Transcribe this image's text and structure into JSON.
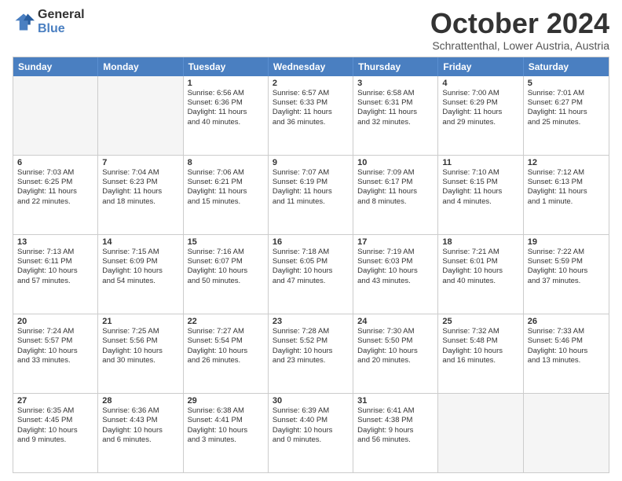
{
  "header": {
    "logo_general": "General",
    "logo_blue": "Blue",
    "title": "October 2024",
    "subtitle": "Schrattenthal, Lower Austria, Austria"
  },
  "weekdays": [
    "Sunday",
    "Monday",
    "Tuesday",
    "Wednesday",
    "Thursday",
    "Friday",
    "Saturday"
  ],
  "rows": [
    [
      {
        "day": "",
        "lines": [],
        "empty": true
      },
      {
        "day": "",
        "lines": [],
        "empty": true
      },
      {
        "day": "1",
        "lines": [
          "Sunrise: 6:56 AM",
          "Sunset: 6:36 PM",
          "Daylight: 11 hours",
          "and 40 minutes."
        ]
      },
      {
        "day": "2",
        "lines": [
          "Sunrise: 6:57 AM",
          "Sunset: 6:33 PM",
          "Daylight: 11 hours",
          "and 36 minutes."
        ]
      },
      {
        "day": "3",
        "lines": [
          "Sunrise: 6:58 AM",
          "Sunset: 6:31 PM",
          "Daylight: 11 hours",
          "and 32 minutes."
        ]
      },
      {
        "day": "4",
        "lines": [
          "Sunrise: 7:00 AM",
          "Sunset: 6:29 PM",
          "Daylight: 11 hours",
          "and 29 minutes."
        ]
      },
      {
        "day": "5",
        "lines": [
          "Sunrise: 7:01 AM",
          "Sunset: 6:27 PM",
          "Daylight: 11 hours",
          "and 25 minutes."
        ]
      }
    ],
    [
      {
        "day": "6",
        "lines": [
          "Sunrise: 7:03 AM",
          "Sunset: 6:25 PM",
          "Daylight: 11 hours",
          "and 22 minutes."
        ]
      },
      {
        "day": "7",
        "lines": [
          "Sunrise: 7:04 AM",
          "Sunset: 6:23 PM",
          "Daylight: 11 hours",
          "and 18 minutes."
        ]
      },
      {
        "day": "8",
        "lines": [
          "Sunrise: 7:06 AM",
          "Sunset: 6:21 PM",
          "Daylight: 11 hours",
          "and 15 minutes."
        ]
      },
      {
        "day": "9",
        "lines": [
          "Sunrise: 7:07 AM",
          "Sunset: 6:19 PM",
          "Daylight: 11 hours",
          "and 11 minutes."
        ]
      },
      {
        "day": "10",
        "lines": [
          "Sunrise: 7:09 AM",
          "Sunset: 6:17 PM",
          "Daylight: 11 hours",
          "and 8 minutes."
        ]
      },
      {
        "day": "11",
        "lines": [
          "Sunrise: 7:10 AM",
          "Sunset: 6:15 PM",
          "Daylight: 11 hours",
          "and 4 minutes."
        ]
      },
      {
        "day": "12",
        "lines": [
          "Sunrise: 7:12 AM",
          "Sunset: 6:13 PM",
          "Daylight: 11 hours",
          "and 1 minute."
        ]
      }
    ],
    [
      {
        "day": "13",
        "lines": [
          "Sunrise: 7:13 AM",
          "Sunset: 6:11 PM",
          "Daylight: 10 hours",
          "and 57 minutes."
        ]
      },
      {
        "day": "14",
        "lines": [
          "Sunrise: 7:15 AM",
          "Sunset: 6:09 PM",
          "Daylight: 10 hours",
          "and 54 minutes."
        ]
      },
      {
        "day": "15",
        "lines": [
          "Sunrise: 7:16 AM",
          "Sunset: 6:07 PM",
          "Daylight: 10 hours",
          "and 50 minutes."
        ]
      },
      {
        "day": "16",
        "lines": [
          "Sunrise: 7:18 AM",
          "Sunset: 6:05 PM",
          "Daylight: 10 hours",
          "and 47 minutes."
        ]
      },
      {
        "day": "17",
        "lines": [
          "Sunrise: 7:19 AM",
          "Sunset: 6:03 PM",
          "Daylight: 10 hours",
          "and 43 minutes."
        ]
      },
      {
        "day": "18",
        "lines": [
          "Sunrise: 7:21 AM",
          "Sunset: 6:01 PM",
          "Daylight: 10 hours",
          "and 40 minutes."
        ]
      },
      {
        "day": "19",
        "lines": [
          "Sunrise: 7:22 AM",
          "Sunset: 5:59 PM",
          "Daylight: 10 hours",
          "and 37 minutes."
        ]
      }
    ],
    [
      {
        "day": "20",
        "lines": [
          "Sunrise: 7:24 AM",
          "Sunset: 5:57 PM",
          "Daylight: 10 hours",
          "and 33 minutes."
        ]
      },
      {
        "day": "21",
        "lines": [
          "Sunrise: 7:25 AM",
          "Sunset: 5:56 PM",
          "Daylight: 10 hours",
          "and 30 minutes."
        ]
      },
      {
        "day": "22",
        "lines": [
          "Sunrise: 7:27 AM",
          "Sunset: 5:54 PM",
          "Daylight: 10 hours",
          "and 26 minutes."
        ]
      },
      {
        "day": "23",
        "lines": [
          "Sunrise: 7:28 AM",
          "Sunset: 5:52 PM",
          "Daylight: 10 hours",
          "and 23 minutes."
        ]
      },
      {
        "day": "24",
        "lines": [
          "Sunrise: 7:30 AM",
          "Sunset: 5:50 PM",
          "Daylight: 10 hours",
          "and 20 minutes."
        ]
      },
      {
        "day": "25",
        "lines": [
          "Sunrise: 7:32 AM",
          "Sunset: 5:48 PM",
          "Daylight: 10 hours",
          "and 16 minutes."
        ]
      },
      {
        "day": "26",
        "lines": [
          "Sunrise: 7:33 AM",
          "Sunset: 5:46 PM",
          "Daylight: 10 hours",
          "and 13 minutes."
        ]
      }
    ],
    [
      {
        "day": "27",
        "lines": [
          "Sunrise: 6:35 AM",
          "Sunset: 4:45 PM",
          "Daylight: 10 hours",
          "and 9 minutes."
        ]
      },
      {
        "day": "28",
        "lines": [
          "Sunrise: 6:36 AM",
          "Sunset: 4:43 PM",
          "Daylight: 10 hours",
          "and 6 minutes."
        ]
      },
      {
        "day": "29",
        "lines": [
          "Sunrise: 6:38 AM",
          "Sunset: 4:41 PM",
          "Daylight: 10 hours",
          "and 3 minutes."
        ]
      },
      {
        "day": "30",
        "lines": [
          "Sunrise: 6:39 AM",
          "Sunset: 4:40 PM",
          "Daylight: 10 hours",
          "and 0 minutes."
        ]
      },
      {
        "day": "31",
        "lines": [
          "Sunrise: 6:41 AM",
          "Sunset: 4:38 PM",
          "Daylight: 9 hours",
          "and 56 minutes."
        ]
      },
      {
        "day": "",
        "lines": [],
        "empty": true
      },
      {
        "day": "",
        "lines": [],
        "empty": true
      }
    ]
  ]
}
